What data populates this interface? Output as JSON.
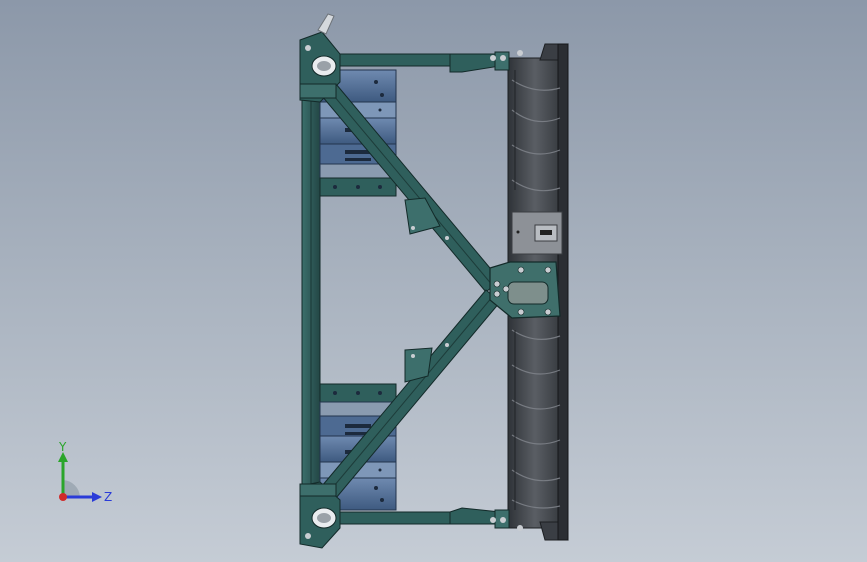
{
  "view": {
    "triad": {
      "y_label": "Y",
      "z_label": "Z",
      "y_color": "#2aa52a",
      "z_color": "#2a3bd8",
      "x_color": "#d02a2a"
    },
    "colors": {
      "frame": "#2e5c5a",
      "frame_edge": "#183332",
      "plate_blue": "#4d6a92",
      "plate_light": "#7e97b8",
      "bracket": "#3d6f6c",
      "hub_plate": "#3f6f6b",
      "fan_dark": "#3a3e44",
      "fan_mid": "#5d6167",
      "fan_light": "#7c8087",
      "bolt": "#c9cdd2"
    }
  }
}
